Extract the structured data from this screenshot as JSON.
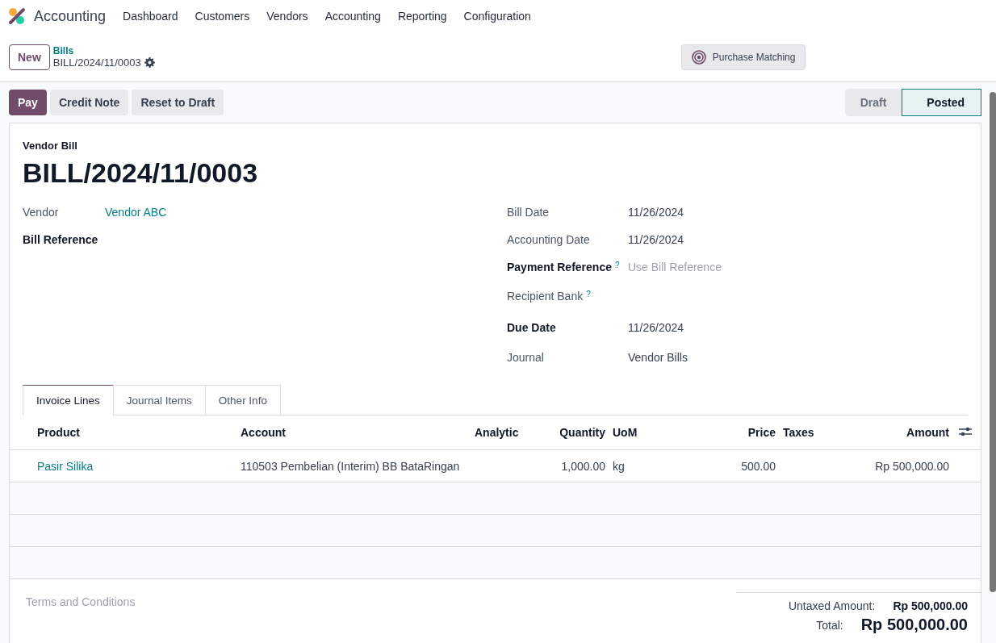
{
  "app": {
    "name": "Accounting"
  },
  "menu": [
    "Dashboard",
    "Customers",
    "Vendors",
    "Accounting",
    "Reporting",
    "Configuration"
  ],
  "control_panel": {
    "new_button": "New",
    "breadcrumb": "Bills",
    "record": "BILL/2024/11/0003",
    "smart_button": "Purchase Matching"
  },
  "actions": [
    {
      "label": "Pay",
      "kind": "primary"
    },
    {
      "label": "Credit Note",
      "kind": "secondary"
    },
    {
      "label": "Reset to Draft",
      "kind": "secondary"
    }
  ],
  "statusbar": [
    {
      "label": "Draft",
      "selected": false
    },
    {
      "label": "Posted",
      "selected": true
    }
  ],
  "form": {
    "type_label": "Vendor Bill",
    "title": "BILL/2024/11/0003",
    "left_fields": [
      {
        "label": "Vendor",
        "required": false,
        "value": "Vendor ABC",
        "kind": "link"
      },
      {
        "label": "Bill Reference",
        "required": true
      }
    ],
    "right_fields": [
      {
        "label": "Bill Date",
        "required": false,
        "value": "11/26/2024",
        "kind": "text"
      },
      {
        "label": "Accounting Date",
        "required": false,
        "value": "11/26/2024",
        "kind": "text"
      },
      {
        "label": "Payment Reference",
        "required": true,
        "help": "?",
        "placeholder": "Use Bill Reference",
        "kind": "input"
      },
      {
        "label": "Recipient Bank",
        "required": false,
        "help": "?"
      },
      {
        "label": "Due Date",
        "required": true,
        "value": "11/26/2024",
        "kind": "text"
      },
      {
        "label": "Journal",
        "required": false,
        "value": "Vendor Bills",
        "kind": "text"
      }
    ]
  },
  "tabs": [
    {
      "label": "Invoice Lines",
      "selected": true
    },
    {
      "label": "Journal Items",
      "selected": false
    },
    {
      "label": "Other Info",
      "selected": false
    }
  ],
  "table": {
    "columns": [
      {
        "label": "Product",
        "numeric": false
      },
      {
        "label": "Account",
        "numeric": false
      },
      {
        "label": "Analytic",
        "numeric": false
      },
      {
        "label": "Quantity",
        "numeric": true
      },
      {
        "label": "UoM",
        "numeric": false
      },
      {
        "label": "Price",
        "numeric": true
      },
      {
        "label": "Taxes",
        "numeric": false
      },
      {
        "label": "Amount",
        "numeric": true
      }
    ],
    "rows": [
      [
        "Pasir Silika",
        "110503 Pembelian (Interim) BB BataRingan",
        "",
        "1,000.00",
        "kg",
        "500.00",
        "",
        "Rp 500,000.00"
      ]
    ]
  },
  "terms_placeholder": "Terms and Conditions",
  "totals": [
    {
      "label": "Untaxed Amount:",
      "value": "Rp 500,000.00",
      "kind": "subtotal"
    },
    {
      "label": "Total:",
      "value": "Rp 500,000.00",
      "kind": "total"
    }
  ]
}
